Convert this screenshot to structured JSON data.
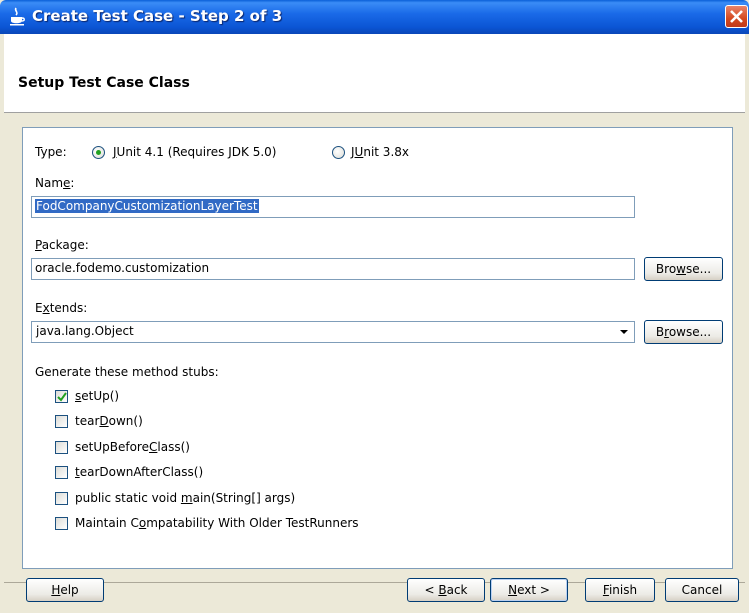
{
  "window": {
    "title": "Create Test Case - Step 2 of 3"
  },
  "header": {
    "title": "Setup Test Case Class"
  },
  "type": {
    "label": "Type:",
    "options": [
      {
        "pre": "",
        "mn": "J",
        "post": "Unit 4.1 (Requires JDK 5.0)",
        "checked": true
      },
      {
        "pre": "J",
        "mn": "U",
        "post": "nit 3.8x",
        "checked": false
      }
    ]
  },
  "name": {
    "label_pre": "Nam",
    "label_mn": "e",
    "label_post": ":",
    "value": "FodCompanyCustomizationLayerTest"
  },
  "package": {
    "label_pre": "",
    "label_mn": "P",
    "label_post": "ackage:",
    "value": "oracle.fodemo.customization",
    "browse_pre": "Bro",
    "browse_mn": "w",
    "browse_post": "se..."
  },
  "extends": {
    "label_pre": "E",
    "label_mn": "x",
    "label_post": "tends:",
    "value": "java.lang.Object",
    "browse_pre": "B",
    "browse_mn": "r",
    "browse_post": "owse..."
  },
  "stubs": {
    "label": "Generate these method stubs:",
    "items": [
      {
        "pre": "",
        "mn": "s",
        "post": "etUp()",
        "checked": true
      },
      {
        "pre": "tear",
        "mn": "D",
        "post": "own()",
        "checked": false
      },
      {
        "pre": "setUpBefore",
        "mn": "C",
        "post": "lass()",
        "checked": false
      },
      {
        "pre": "",
        "mn": "t",
        "post": "earDownAfterClass()",
        "checked": false
      },
      {
        "pre": "public static void ",
        "mn": "m",
        "post": "ain(String[] args)",
        "checked": false
      },
      {
        "pre": "Maintain C",
        "mn": "o",
        "post": "mpatability With Older TestRunners",
        "checked": false
      }
    ]
  },
  "buttons": {
    "help": {
      "pre": "",
      "mn": "H",
      "post": "elp"
    },
    "back": {
      "pre": "< ",
      "mn": "B",
      "post": "ack"
    },
    "next": {
      "pre": "",
      "mn": "N",
      "post": "ext >"
    },
    "finish": {
      "pre": "",
      "mn": "F",
      "post": "inish"
    },
    "cancel": {
      "pre": "Cancel",
      "mn": "",
      "post": ""
    }
  }
}
